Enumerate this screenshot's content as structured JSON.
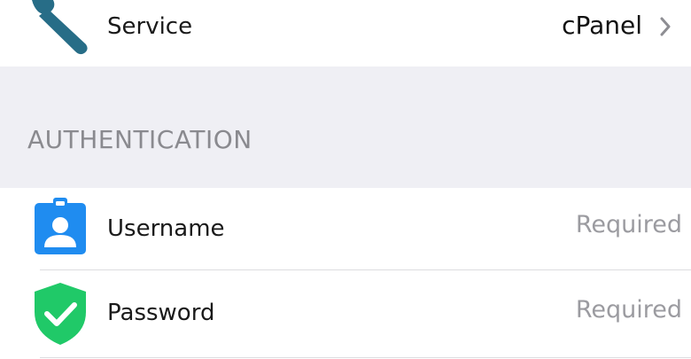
{
  "service": {
    "label": "Service",
    "value": "cPanel",
    "icon": "wrench-icon",
    "icon_color": "#276d87"
  },
  "authentication": {
    "header": "AUTHENTICATION",
    "username": {
      "label": "Username",
      "placeholder": "Required",
      "icon": "id-badge-icon",
      "icon_color": "#1f8cf0"
    },
    "password": {
      "label": "Password",
      "placeholder": "Required",
      "icon": "shield-check-icon",
      "icon_color": "#20c968"
    }
  },
  "colors": {
    "group_background": "#efeff4",
    "header_text": "#8a8a8f",
    "placeholder_text": "#9b9ba0",
    "chevron": "#8e8e93"
  }
}
